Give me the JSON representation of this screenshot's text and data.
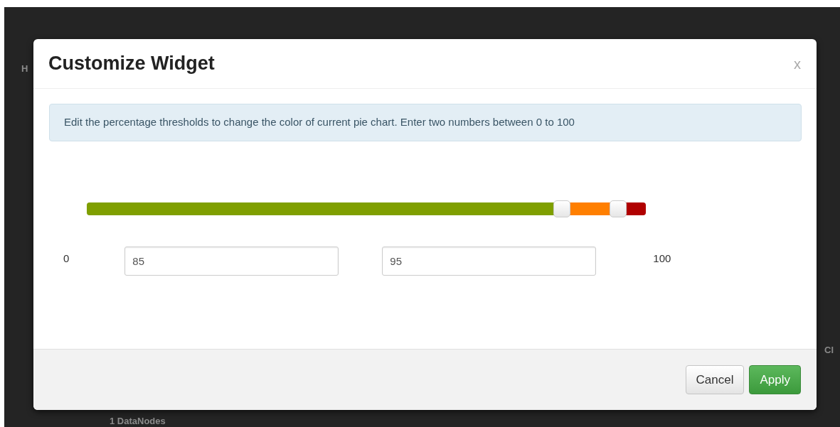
{
  "background": {
    "texts": [
      "H",
      "Cl",
      "1 DataNodes"
    ]
  },
  "dialog": {
    "title": "Customize Widget",
    "close": "x",
    "info": "Edit the percentage thresholds to change the color of current pie chart. Enter two numbers between 0 to 100",
    "slider": {
      "segments": [
        {
          "color": "#7f9f00"
        },
        {
          "color": "#ff7f00"
        },
        {
          "color": "#b00000"
        }
      ],
      "handles": [
        {
          "level": 0.85
        },
        {
          "level": 0.95
        }
      ]
    },
    "min_label": "0",
    "max_label": "100",
    "inputs": [
      {
        "value": "85"
      },
      {
        "value": "95"
      }
    ],
    "buttons": [
      {
        "label": "Cancel",
        "kind": "default"
      },
      {
        "label": "Apply",
        "kind": "primary"
      }
    ]
  }
}
